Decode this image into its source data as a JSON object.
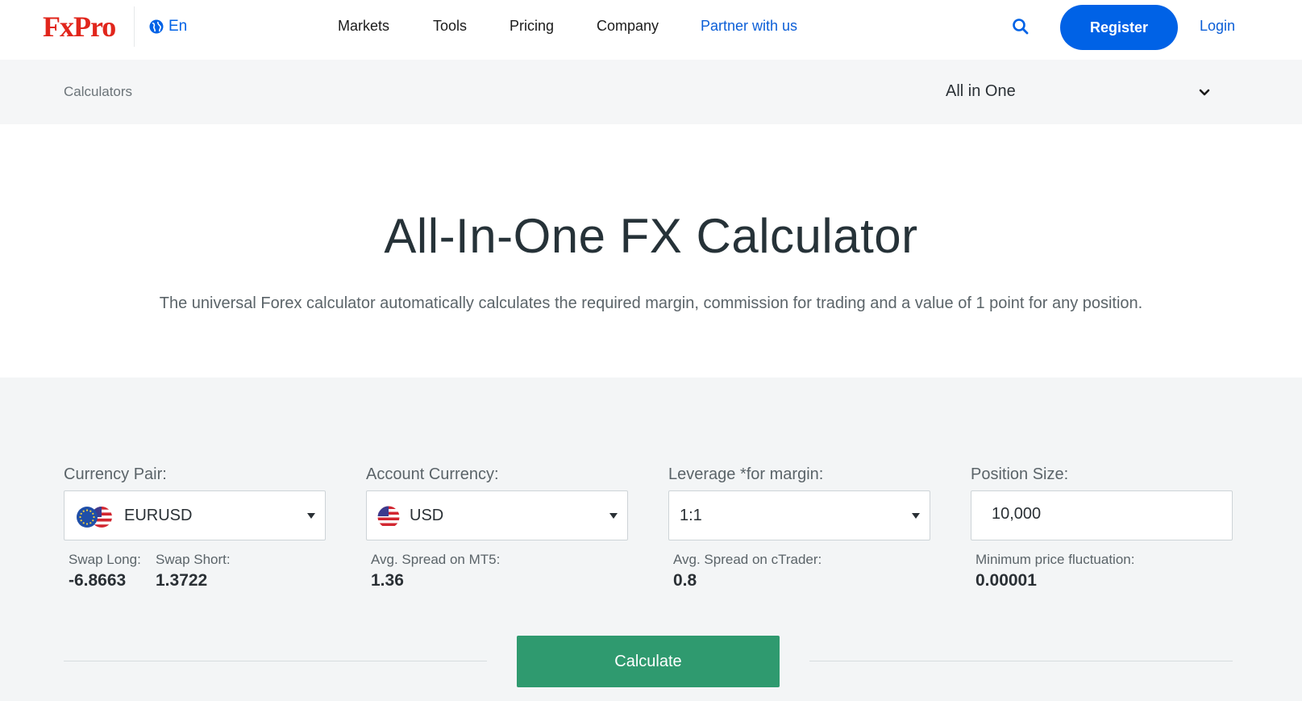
{
  "brand": {
    "logo": "FxPro",
    "accent": "#0062e6",
    "logo_color": "#e1261c"
  },
  "header": {
    "language": "En",
    "nav": [
      "Markets",
      "Tools",
      "Pricing",
      "Company",
      "Partner with us"
    ],
    "register": "Register",
    "login": "Login"
  },
  "subbar": {
    "breadcrumb": "Calculators",
    "calculator_select": "All in One"
  },
  "hero": {
    "title": "All-In-One FX Calculator",
    "description": "The universal Forex calculator automatically calculates the required margin, commission for trading and a value of 1 point for any position."
  },
  "calculator": {
    "currency_pair": {
      "label": "Currency Pair:",
      "value": "EURUSD",
      "icon": "eu-us-flag-icon"
    },
    "account_currency": {
      "label": "Account Currency:",
      "value": "USD",
      "icon": "us-flag-icon"
    },
    "leverage": {
      "label": "Leverage *for margin:",
      "value": "1:1"
    },
    "position_size": {
      "label": "Position Size:",
      "value": "10,000"
    },
    "swap_long": {
      "label": "Swap Long:",
      "value": "-6.8663"
    },
    "swap_short": {
      "label": "Swap Short:",
      "value": "1.3722"
    },
    "spread_mt5": {
      "label": "Avg. Spread on MT5:",
      "value": "1.36"
    },
    "spread_ctrader": {
      "label": "Avg. Spread on cTrader:",
      "value": "0.8"
    },
    "min_fluctuation": {
      "label": "Minimum price fluctuation:",
      "value": "0.00001"
    },
    "calculate": "Calculate",
    "button_color": "#2f9a6f"
  }
}
